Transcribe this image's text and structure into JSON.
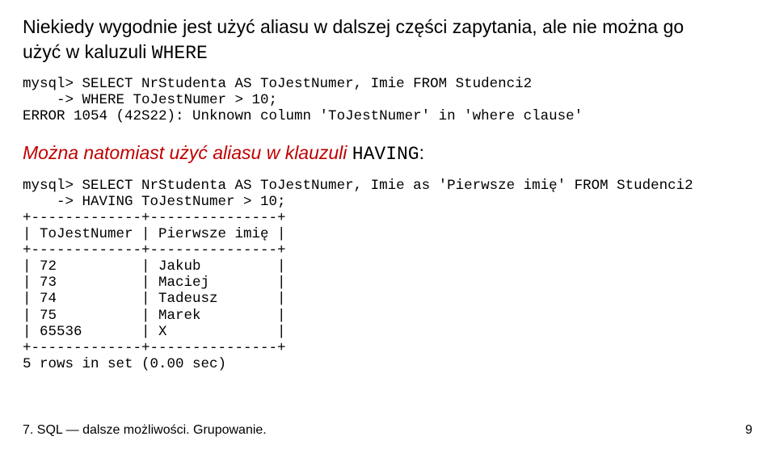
{
  "intro": {
    "line1": "Niekiedy wygodnie jest użyć aliasu w dalszej części zapytania, ale nie można go",
    "line2_prefix": "użyć w kaluzuli ",
    "line2_where": "WHERE"
  },
  "code1": "mysql> SELECT NrStudenta AS ToJestNumer, Imie FROM Studenci2\n    -> WHERE ToJestNumer > 10;\nERROR 1054 (42S22): Unknown column 'ToJestNumer' in 'where clause'",
  "mozna": {
    "italic_part": "Można natomiast użyć aliasu w klauzuli ",
    "having": "HAVING",
    "colon": ":"
  },
  "code2": "mysql> SELECT NrStudenta AS ToJestNumer, Imie as 'Pierwsze imię' FROM Studenci2\n    -> HAVING ToJestNumer > 10;\n+-------------+---------------+\n| ToJestNumer | Pierwsze imię |\n+-------------+---------------+\n| 72          | Jakub         |\n| 73          | Maciej        |\n| 74          | Tadeusz       |\n| 75          | Marek         |\n| 65536       | X             |\n+-------------+---------------+\n5 rows in set (0.00 sec)",
  "footer": {
    "left": "7. SQL — dalsze możliwości. Grupowanie.",
    "right": "9"
  },
  "chart_data": {
    "type": "table",
    "title": "SELECT NrStudenta AS ToJestNumer, Imie as 'Pierwsze imię' FROM Studenci2 HAVING ToJestNumer > 10",
    "columns": [
      "ToJestNumer",
      "Pierwsze imię"
    ],
    "rows": [
      [
        72,
        "Jakub"
      ],
      [
        73,
        "Maciej"
      ],
      [
        74,
        "Tadeusz"
      ],
      [
        75,
        "Marek"
      ],
      [
        65536,
        "X"
      ]
    ],
    "row_count_text": "5 rows in set (0.00 sec)"
  }
}
